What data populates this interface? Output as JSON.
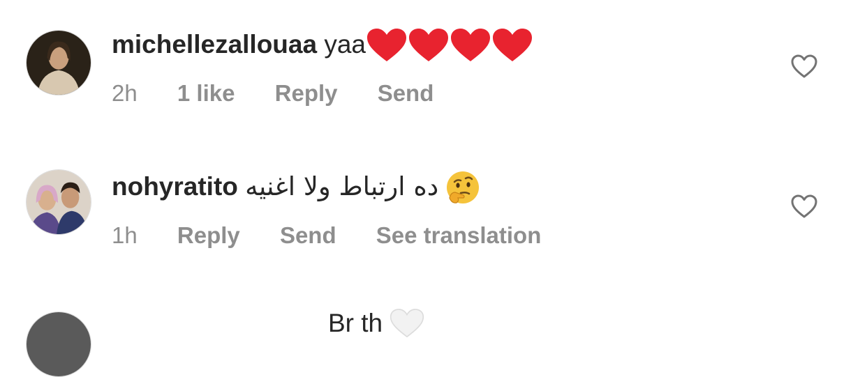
{
  "comments": [
    {
      "username": "michellezallouaa",
      "text": "yaa",
      "emoji": "red-heart x4",
      "time": "2h",
      "likes": "1 like",
      "reply": "Reply",
      "send": "Send"
    },
    {
      "username": "nohyratito",
      "text": "ده ارتباط ولا اغنيه",
      "emoji": "thinking-face",
      "time": "1h",
      "reply": "Reply",
      "send": "Send",
      "translate": "See translation"
    },
    {
      "username": "",
      "text": "Br th",
      "emoji": "white-heart"
    }
  ],
  "colors": {
    "text": "#262626",
    "secondary": "#8e8e8e",
    "heart": "#e8232f",
    "emoji_yellow": "#f5c33b"
  }
}
